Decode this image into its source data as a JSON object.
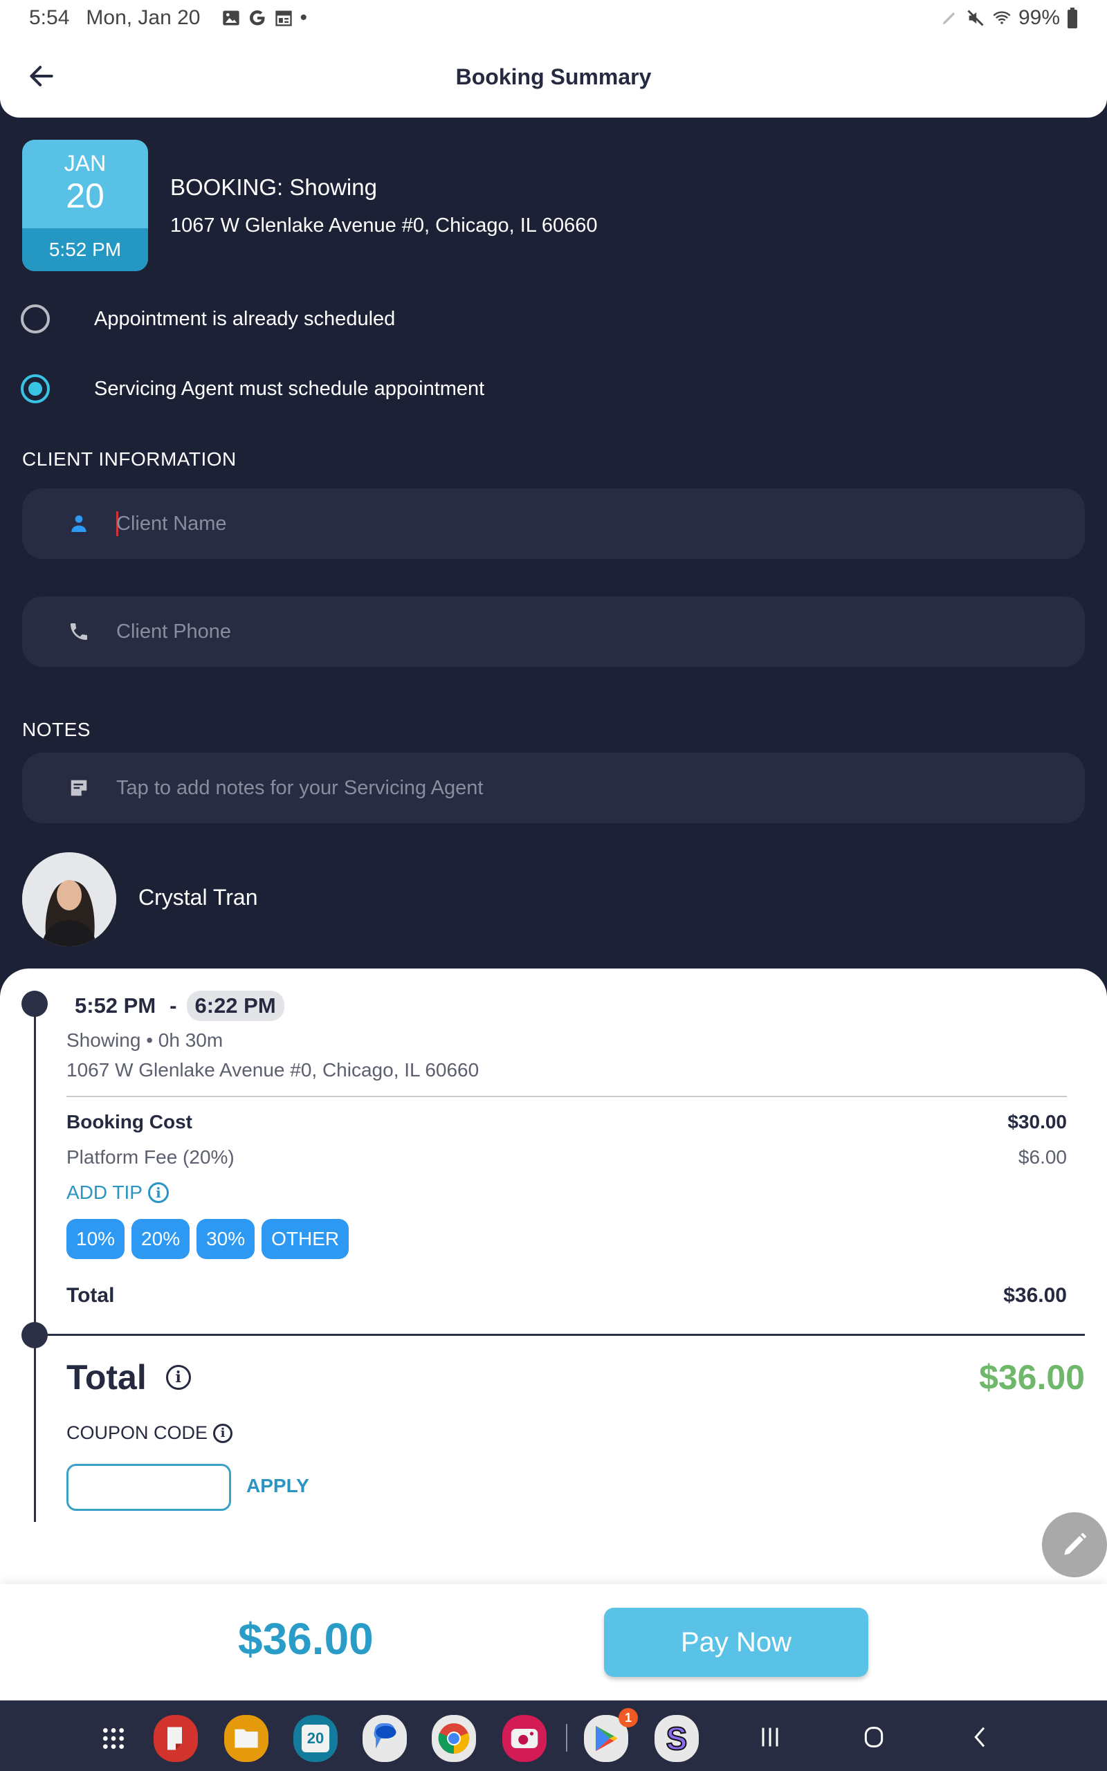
{
  "status_bar": {
    "time": "5:54",
    "date": "Mon, Jan 20",
    "notification_icons": [
      "gallery-icon",
      "google-icon",
      "news-icon"
    ],
    "more_dot": "•",
    "system_icons": [
      "stylus-icon",
      "mute-icon",
      "wifi-icon"
    ],
    "battery": "99%"
  },
  "header": {
    "title": "Booking Summary",
    "back_icon": "arrow-left-icon"
  },
  "booking": {
    "month": "JAN",
    "day": "20",
    "time": "5:52 PM",
    "title": "BOOKING: Showing",
    "address": "1067 W Glenlake Avenue #0, Chicago, IL 60660"
  },
  "schedule_options": [
    {
      "label": "Appointment is already scheduled",
      "selected": false
    },
    {
      "label": "Servicing Agent must schedule appointment",
      "selected": true
    }
  ],
  "client_info": {
    "section_label": "CLIENT INFORMATION",
    "name_placeholder": "Client Name",
    "name_value": "",
    "phone_placeholder": "Client Phone",
    "phone_value": ""
  },
  "notes": {
    "section_label": "NOTES",
    "placeholder": "Tap to add notes for your Servicing Agent"
  },
  "agent": {
    "name": "Crystal Tran"
  },
  "summary": {
    "start_time": "5:52 PM",
    "separator": "-",
    "end_time": "6:22 PM",
    "service_type": "Showing",
    "bullet": "•",
    "duration": "0h 30m",
    "address": "1067 W Glenlake Avenue #0, Chicago, IL 60660",
    "line_items": [
      {
        "label": "Booking Cost",
        "value": "$30.00"
      },
      {
        "label": "Platform Fee (20%)",
        "value": "$6.00"
      }
    ],
    "add_tip_label": "ADD TIP",
    "tip_options": [
      "10%",
      "20%",
      "30%",
      "OTHER"
    ],
    "subtotal_label": "Total",
    "subtotal_value": "$36.00",
    "grand_total_label": "Total",
    "grand_total_value": "$36.00",
    "coupon_label": "COUPON CODE",
    "coupon_value": "",
    "apply_label": "APPLY"
  },
  "pay_bar": {
    "amount": "$36.00",
    "pay_label": "Pay Now"
  },
  "colors": {
    "background_dark": "#1d2136",
    "accent_blue": "#5ac2e6",
    "tip_blue": "#2d99f2",
    "total_green": "#6fb76a",
    "link_blue": "#2a94c2"
  },
  "taskbar": {
    "apps": [
      {
        "name": "app-drawer-icon"
      },
      {
        "name": "samsung-notes-icon"
      },
      {
        "name": "my-files-icon"
      },
      {
        "name": "calendar-icon",
        "label": "20"
      },
      {
        "name": "messages-icon"
      },
      {
        "name": "chrome-icon"
      },
      {
        "name": "screen-recorder-icon"
      },
      {
        "name": "play-store-icon",
        "badge": "1"
      },
      {
        "name": "s-app-icon",
        "label": "S"
      }
    ],
    "nav": [
      "recents-icon",
      "home-icon",
      "back-icon"
    ]
  }
}
